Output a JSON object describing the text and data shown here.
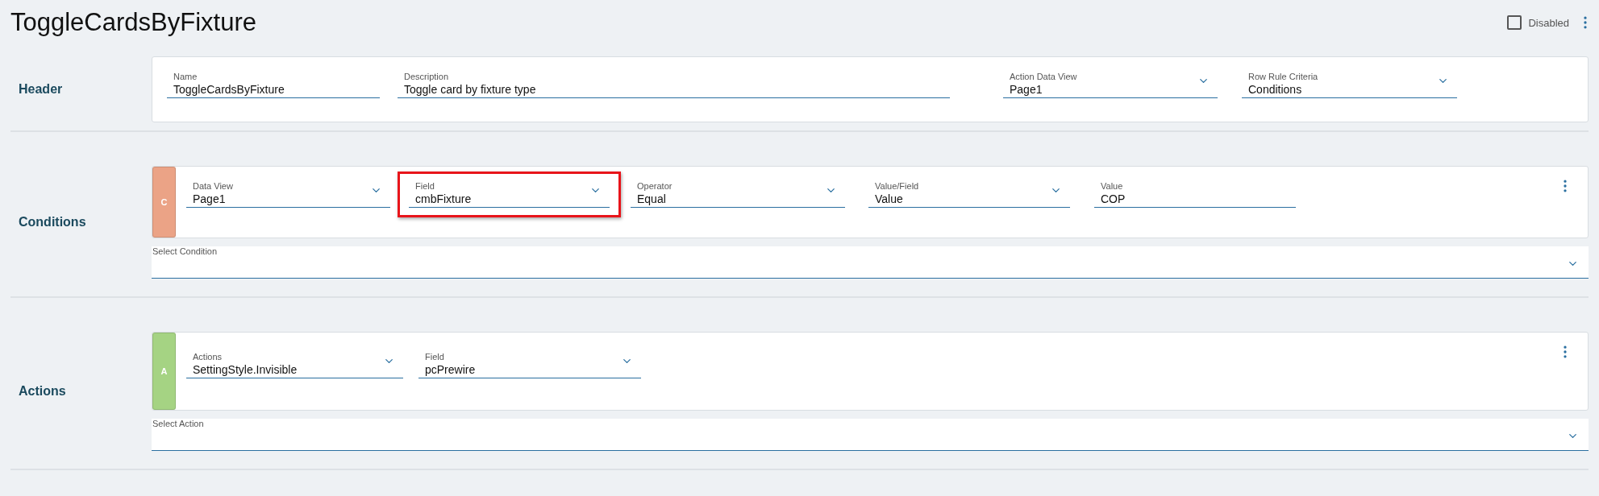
{
  "title": "ToggleCardsByFixture",
  "disabled": {
    "label": "Disabled",
    "checked": false
  },
  "sections": [
    {
      "kind": "header",
      "label": "Header",
      "fields": [
        {
          "kind": "text",
          "label": "Name",
          "value": "ToggleCardsByFixture",
          "highlighted": false
        },
        {
          "kind": "text",
          "label": "Description",
          "value": "Toggle card by fixture type",
          "highlighted": false
        },
        {
          "kind": "dropdown",
          "label": "Action Data View",
          "value": "Page1",
          "highlighted": false
        },
        {
          "kind": "dropdown",
          "label": "Row Rule Criteria",
          "value": "Conditions",
          "highlighted": false
        }
      ]
    },
    {
      "kind": "rules",
      "label": "Conditions",
      "badge": "C",
      "color": "#eba386",
      "select": "Select Condition",
      "fields": [
        {
          "kind": "dropdown",
          "label": "Data View",
          "value": "Page1",
          "highlighted": false
        },
        {
          "kind": "dropdown",
          "label": "Field",
          "value": "cmbFixture",
          "highlighted": true
        },
        {
          "kind": "dropdown",
          "label": "Operator",
          "value": "Equal",
          "highlighted": false
        },
        {
          "kind": "dropdown",
          "label": "Value/Field",
          "value": "Value",
          "highlighted": false
        },
        {
          "kind": "text",
          "label": "Value",
          "value": "COP",
          "highlighted": false
        }
      ]
    },
    {
      "kind": "rules",
      "label": "Actions",
      "badge": "A",
      "color": "#a5d383",
      "select": "Select Action",
      "fields": [
        {
          "kind": "dropdown",
          "label": "Actions",
          "value": "SettingStyle.Invisible",
          "highlighted": false
        },
        {
          "kind": "dropdown",
          "label": "Field",
          "value": "pcPrewire",
          "highlighted": false
        }
      ]
    }
  ]
}
